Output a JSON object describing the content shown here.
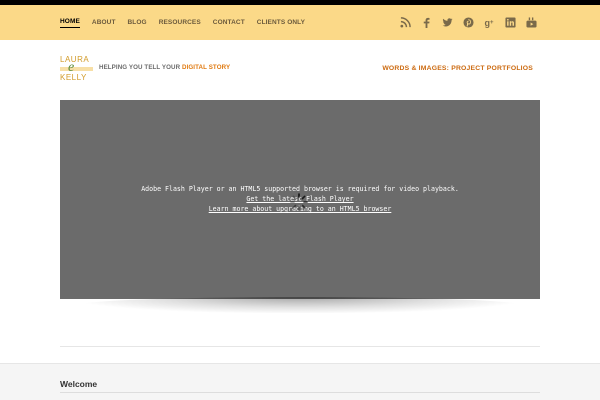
{
  "nav": {
    "items": [
      {
        "label": "HOME",
        "active": true
      },
      {
        "label": "ABOUT",
        "active": false
      },
      {
        "label": "BLOG",
        "active": false
      },
      {
        "label": "RESOURCES",
        "active": false
      },
      {
        "label": "CONTACT",
        "active": false
      },
      {
        "label": "CLIENTS ONLY",
        "active": false
      }
    ]
  },
  "social": {
    "icons": [
      "rss-icon",
      "facebook-icon",
      "twitter-icon",
      "pinterest-icon",
      "google-plus-icon",
      "linkedin-icon",
      "youtube-icon"
    ]
  },
  "header": {
    "logo_line1": "LAURA",
    "logo_e": "e",
    "logo_line3": "KELLY",
    "tagline_prefix": "HELPING YOU TELL YOUR ",
    "tagline_accent": "DIGITAL STORY",
    "portfolio_link": "WORDS & IMAGES: PROJECT PORTFOLIOS"
  },
  "video": {
    "message": "Adobe Flash Player or an HTML5 supported browser is required for video playback.",
    "link1": "Get the latest Flash Player",
    "link2": "Learn more about upgrading to an HTML5 browser"
  },
  "footer": {
    "welcome": "Welcome"
  },
  "colors": {
    "navbar_bg": "#fbd988",
    "accent_orange": "#e07a10",
    "video_bg": "#6b6b6b"
  }
}
